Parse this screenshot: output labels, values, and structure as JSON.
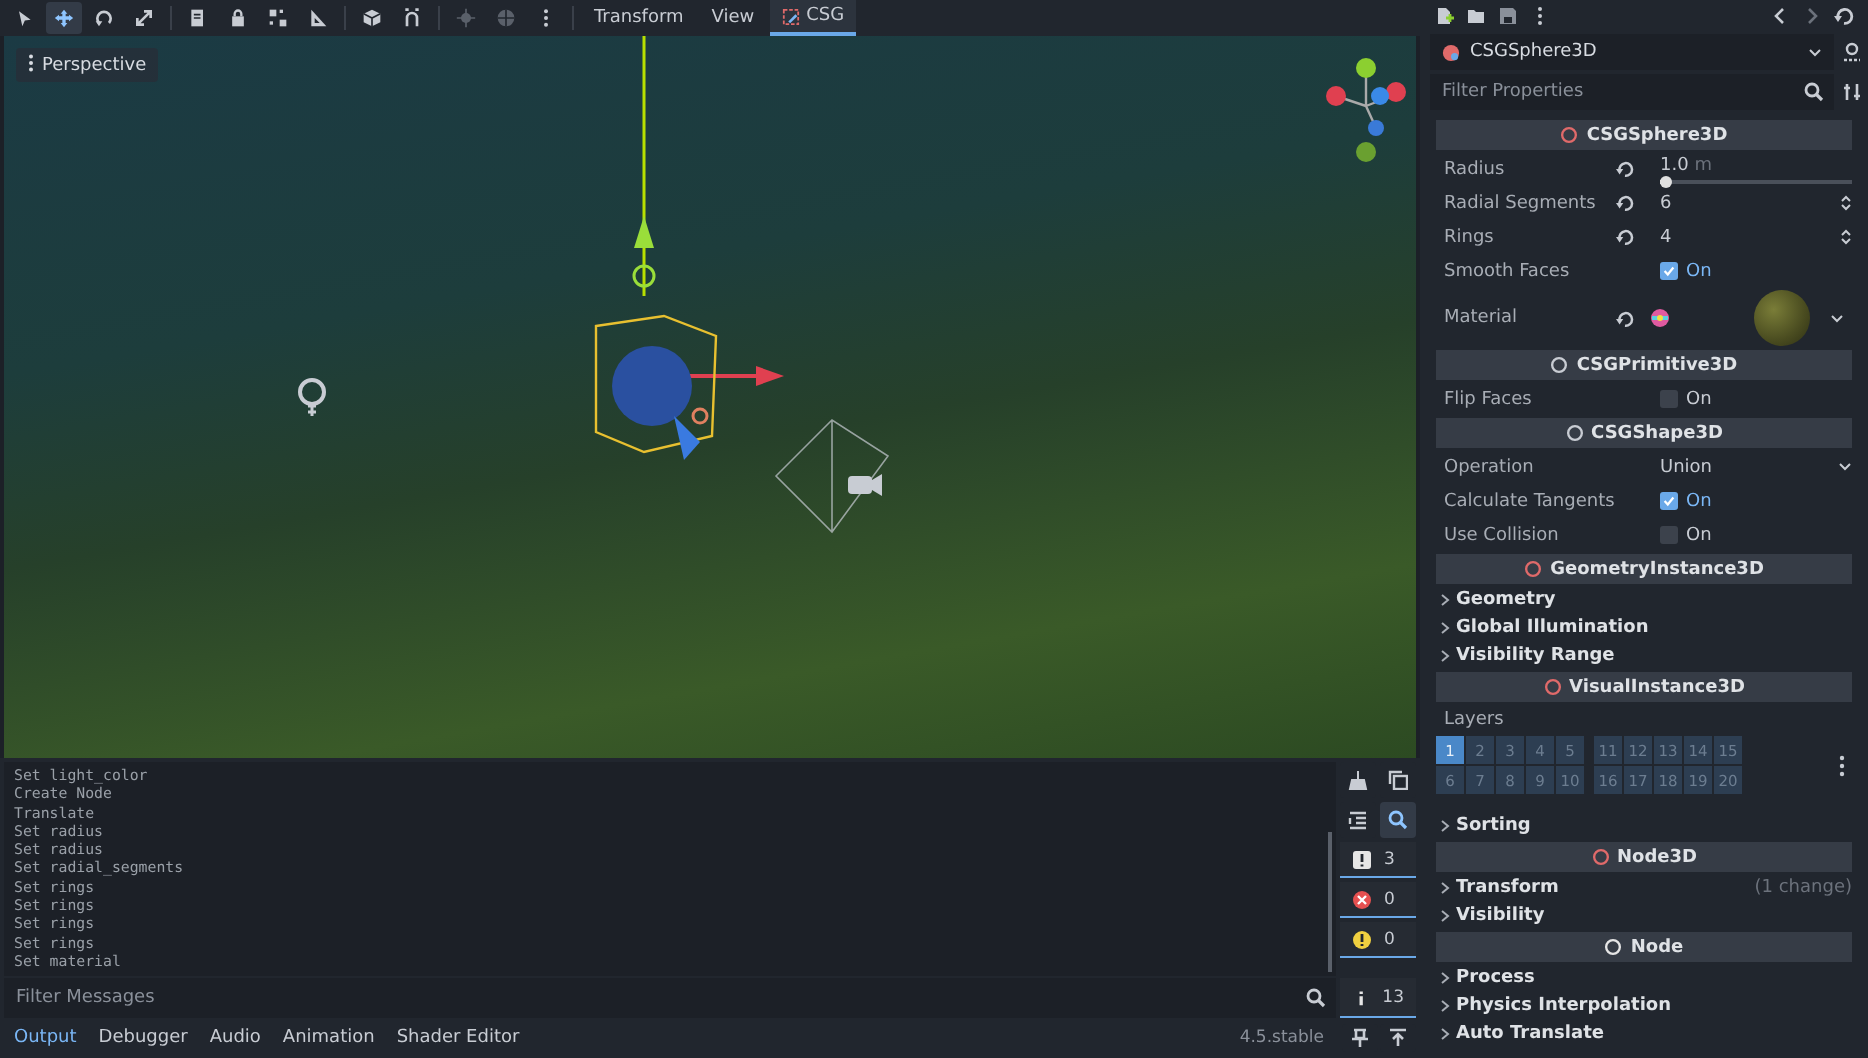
{
  "toolbar": {
    "tools": [
      {
        "kind": "select",
        "selected": false,
        "disabled": false
      },
      {
        "kind": "move",
        "selected": true,
        "disabled": false
      },
      {
        "kind": "rotate",
        "selected": false,
        "disabled": false
      },
      {
        "kind": "scale",
        "selected": false,
        "disabled": false
      },
      {
        "kind": "list",
        "selected": false,
        "disabled": false
      },
      {
        "kind": "lock",
        "selected": false,
        "disabled": false
      },
      {
        "kind": "group",
        "selected": false,
        "disabled": false
      },
      {
        "kind": "ruler",
        "selected": false,
        "disabled": false
      },
      {
        "kind": "cube",
        "selected": false,
        "disabled": false
      },
      {
        "kind": "snap",
        "selected": false,
        "disabled": false
      },
      {
        "kind": "pivot",
        "selected": false,
        "disabled": true
      },
      {
        "kind": "globe",
        "selected": false,
        "disabled": true
      },
      {
        "kind": "more",
        "selected": false,
        "disabled": false
      }
    ],
    "menus": [
      "Transform",
      "View"
    ],
    "tab": {
      "label": "CSG",
      "selected": true
    }
  },
  "viewport": {
    "view_label": "Perspective"
  },
  "inspector": {
    "node": "CSGSphere3D",
    "filter": {
      "placeholder": "Filter Properties"
    },
    "rows": [
      {
        "kind": "header",
        "label": "CSGSphere3D",
        "color": "#e06a6a"
      },
      {
        "kind": "slider",
        "label": "Radius",
        "value": "1.0",
        "unit": "m",
        "level": 0.03,
        "revert": true
      },
      {
        "kind": "spin",
        "label": "Radial Segments",
        "value": "6",
        "revert": true
      },
      {
        "kind": "spin",
        "label": "Rings",
        "value": "4",
        "revert": true
      },
      {
        "kind": "check",
        "label": "Smooth Faces",
        "text": "On",
        "checked": true
      },
      {
        "kind": "material",
        "label": "Material",
        "revert": true
      },
      {
        "kind": "header",
        "label": "CSGPrimitive3D",
        "color": "#c8ccd3"
      },
      {
        "kind": "check",
        "label": "Flip Faces",
        "text": "On",
        "checked": false
      },
      {
        "kind": "header",
        "label": "CSGShape3D",
        "color": "#c8ccd3"
      },
      {
        "kind": "dropdown",
        "label": "Operation",
        "value": "Union"
      },
      {
        "kind": "check",
        "label": "Calculate Tangents",
        "text": "On",
        "checked": true
      },
      {
        "kind": "check",
        "label": "Use Collision",
        "text": "On",
        "checked": false
      },
      {
        "kind": "header",
        "label": "GeometryInstance3D",
        "color": "#e06a6a"
      },
      {
        "kind": "group",
        "label": "Geometry"
      },
      {
        "kind": "group",
        "label": "Global Illumination"
      },
      {
        "kind": "group",
        "label": "Visibility Range"
      },
      {
        "kind": "header",
        "label": "VisualInstance3D",
        "color": "#e06a6a"
      },
      {
        "kind": "layers",
        "label": "Layers",
        "cells": [
          {
            "label": "1",
            "selected": true
          },
          {
            "label": "2",
            "selected": false
          },
          {
            "label": "3",
            "selected": false
          },
          {
            "label": "4",
            "selected": false
          },
          {
            "label": "5",
            "selected": false
          },
          {
            "label": "11",
            "selected": false
          },
          {
            "label": "12",
            "selected": false
          },
          {
            "label": "13",
            "selected": false
          },
          {
            "label": "14",
            "selected": false
          },
          {
            "label": "15",
            "selected": false
          },
          {
            "label": "6",
            "selected": false
          },
          {
            "label": "7",
            "selected": false
          },
          {
            "label": "8",
            "selected": false
          },
          {
            "label": "9",
            "selected": false
          },
          {
            "label": "10",
            "selected": false
          },
          {
            "label": "16",
            "selected": false
          },
          {
            "label": "17",
            "selected": false
          },
          {
            "label": "18",
            "selected": false
          },
          {
            "label": "19",
            "selected": false
          },
          {
            "label": "20",
            "selected": false
          }
        ]
      },
      {
        "kind": "group",
        "label": "Sorting"
      },
      {
        "kind": "header",
        "label": "Node3D",
        "color": "#e06a6a"
      },
      {
        "kind": "group",
        "label": "Transform",
        "note": "(1 change)"
      },
      {
        "kind": "group",
        "label": "Visibility"
      },
      {
        "kind": "header",
        "label": "Node",
        "color": "#e6e6e6"
      },
      {
        "kind": "group",
        "label": "Process"
      },
      {
        "kind": "group",
        "label": "Physics Interpolation"
      },
      {
        "kind": "group",
        "label": "Auto Translate"
      }
    ]
  },
  "output": {
    "lines": [
      "Set light_color",
      "Create Node",
      "Translate",
      "Set radius",
      "Set radius",
      "Set radial_segments",
      "Set rings",
      "Set rings",
      "Set rings",
      "Set rings",
      "Set material"
    ],
    "filter": {
      "placeholder": "Filter Messages"
    },
    "search_on": true,
    "counters": [
      {
        "kind": "message",
        "count": "3",
        "on": true
      },
      {
        "kind": "error",
        "count": "0",
        "on": true
      },
      {
        "kind": "warning",
        "count": "0",
        "on": true
      },
      {
        "kind": "info",
        "count": "13",
        "on": true
      }
    ]
  },
  "bottom_tabs": [
    {
      "label": "Output",
      "selected": true
    },
    {
      "label": "Debugger",
      "selected": false
    },
    {
      "label": "Audio",
      "selected": false
    },
    {
      "label": "Animation",
      "selected": false
    },
    {
      "label": "Shader Editor",
      "selected": false
    }
  ],
  "version": "4.5.stable"
}
